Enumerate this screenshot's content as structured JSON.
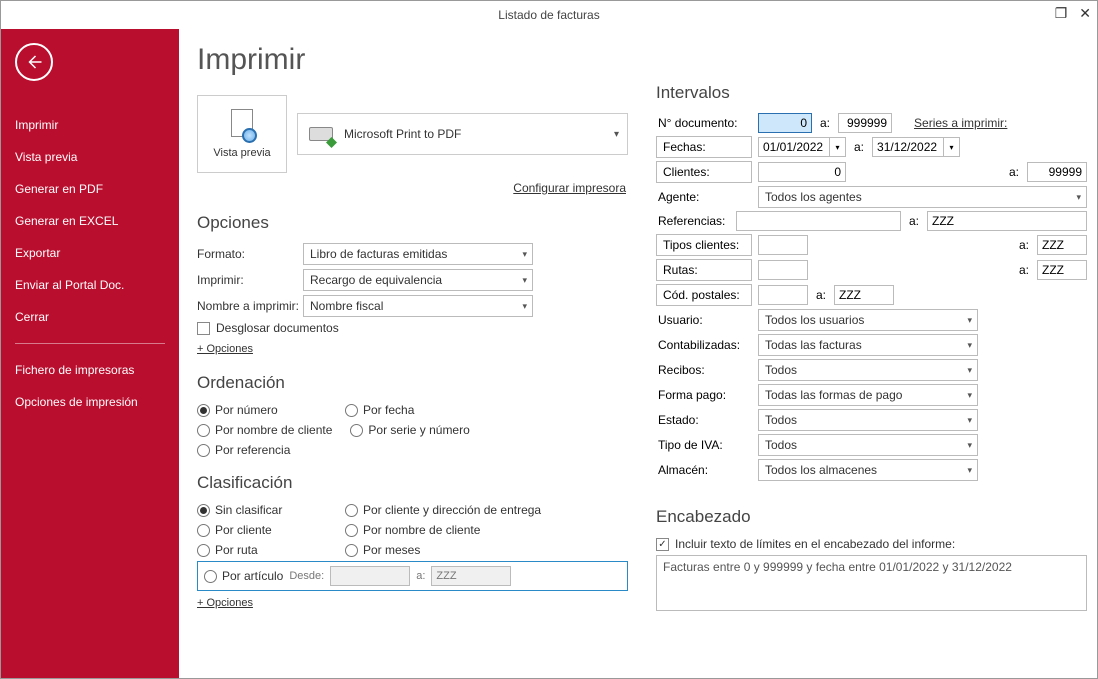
{
  "window": {
    "title": "Listado de facturas"
  },
  "sidebar": {
    "items": [
      "Imprimir",
      "Vista previa",
      "Generar en PDF",
      "Generar en EXCEL",
      "Exportar",
      "Enviar al Portal Doc.",
      "Cerrar"
    ],
    "items2": [
      "Fichero de impresoras",
      "Opciones de impresión"
    ]
  },
  "page": {
    "title": "Imprimir",
    "vistaPrevia": "Vista previa",
    "printer": "Microsoft Print to PDF",
    "configurar": "Configurar impresora"
  },
  "opciones": {
    "heading": "Opciones",
    "formatoLbl": "Formato:",
    "formato": "Libro de facturas emitidas",
    "imprimirLbl": "Imprimir:",
    "imprimir": "Recargo de equivalencia",
    "nombreLbl": "Nombre a imprimir:",
    "nombre": "Nombre fiscal",
    "desglosar": "Desglosar documentos",
    "masOpciones": "+ Opciones"
  },
  "ordenacion": {
    "heading": "Ordenación",
    "items": [
      "Por número",
      "Por fecha",
      "Por nombre de cliente",
      "Por serie y número",
      "Por referencia"
    ],
    "checked": 0
  },
  "clasificacion": {
    "heading": "Clasificación",
    "items": [
      "Sin clasificar",
      "Por cliente y dirección de entrega",
      "Por cliente",
      "Por nombre de cliente",
      "Por ruta",
      "Por meses"
    ],
    "checked": 0,
    "articulo": "Por artículo",
    "desde": "Desde:",
    "a": "a:",
    "zzz": "ZZZ",
    "masOpciones": "+ Opciones"
  },
  "intervalos": {
    "heading": "Intervalos",
    "ndoc": "N° documento:",
    "ndocFrom": "0",
    "ndocTo": "999999",
    "series": "Series a imprimir:",
    "fechas": "Fechas:",
    "fechaFrom": "01/01/2022",
    "fechaTo": "31/12/2022",
    "clientes": "Clientes:",
    "cliFrom": "0",
    "cliTo": "99999",
    "agente": "Agente:",
    "agenteVal": "Todos los agentes",
    "referencias": "Referencias:",
    "refTo": "ZZZ",
    "tiposCli": "Tipos clientes:",
    "tiposTo": "ZZZ",
    "rutas": "Rutas:",
    "rutasTo": "ZZZ",
    "codPost": "Cód. postales:",
    "codTo": "ZZZ",
    "usuario": "Usuario:",
    "usuarioVal": "Todos los usuarios",
    "contab": "Contabilizadas:",
    "contabVal": "Todas las facturas",
    "recibos": "Recibos:",
    "recibosVal": "Todos",
    "forma": "Forma pago:",
    "formaVal": "Todas las formas de pago",
    "estado": "Estado:",
    "estadoVal": "Todos",
    "iva": "Tipo de IVA:",
    "ivaVal": "Todos",
    "almacen": "Almacén:",
    "almacenVal": "Todos los almacenes",
    "a": "a:"
  },
  "encabezado": {
    "heading": "Encabezado",
    "incluir": "Incluir texto de límites en el encabezado del informe:",
    "texto": "Facturas entre 0 y 999999 y fecha entre 01/01/2022 y 31/12/2022"
  }
}
